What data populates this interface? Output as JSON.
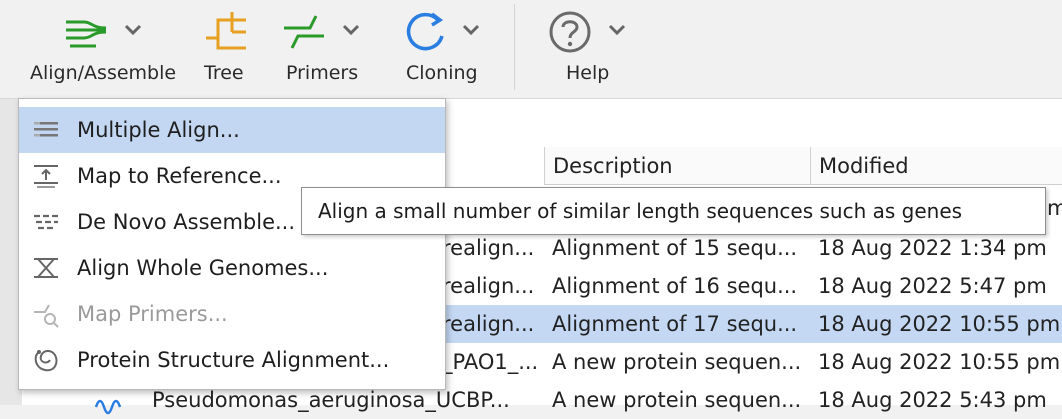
{
  "toolbar": {
    "buttons": [
      {
        "label": "Align/Assemble",
        "icon": "align-assemble-icon",
        "color": "#2a9a2a"
      },
      {
        "label": "Tree",
        "icon": "tree-icon",
        "color": "#e8a020"
      },
      {
        "label": "Primers",
        "icon": "primers-icon",
        "color": "#2a9a2a"
      },
      {
        "label": "Cloning",
        "icon": "cloning-icon",
        "color": "#2a7de1"
      },
      {
        "label": "Help",
        "icon": "help-icon",
        "color": "#6a6a6a"
      }
    ]
  },
  "table": {
    "columns": [
      "Description",
      "Modified"
    ],
    "rows": [
      {
        "name": "",
        "description": "",
        "modified": "m"
      },
      {
        "name": "realign...",
        "description": "Alignment of 15 sequ...",
        "modified": "18 Aug 2022 1:34 pm",
        "selected": false
      },
      {
        "name": "realign...",
        "description": "Alignment of 16 sequ...",
        "modified": "18 Aug 2022 5:47 pm",
        "selected": false
      },
      {
        "name": "realign...",
        "description": "Alignment of 17 sequ...",
        "modified": "18 Aug 2022 10:55 pm",
        "selected": true
      },
      {
        "name": "_PAO1_...",
        "description": "A new protein sequen...",
        "modified": "18 Aug 2022 10:55 pm",
        "selected": false
      },
      {
        "name": "Pseudomonas_aeruginosa_UCBP...",
        "description": "A new protein sequen...",
        "modified": "18 Aug 2022 5:43 pm",
        "selected": false
      }
    ]
  },
  "menu": {
    "items": [
      {
        "label": "Multiple Align...",
        "icon": "multiple-align-icon",
        "highlighted": true,
        "disabled": false
      },
      {
        "label": "Map to Reference...",
        "icon": "map-to-reference-icon",
        "highlighted": false,
        "disabled": false
      },
      {
        "label": "De Novo Assemble...",
        "icon": "de-novo-assemble-icon",
        "highlighted": false,
        "disabled": false
      },
      {
        "label": "Align Whole Genomes...",
        "icon": "align-whole-genomes-icon",
        "highlighted": false,
        "disabled": false
      },
      {
        "label": "Map Primers...",
        "icon": "map-primers-icon",
        "highlighted": false,
        "disabled": true
      },
      {
        "label": "Protein Structure Alignment...",
        "icon": "protein-structure-icon",
        "highlighted": false,
        "disabled": false
      }
    ]
  },
  "tooltip": {
    "text": "Align a small number of similar length sequences such as genes"
  }
}
